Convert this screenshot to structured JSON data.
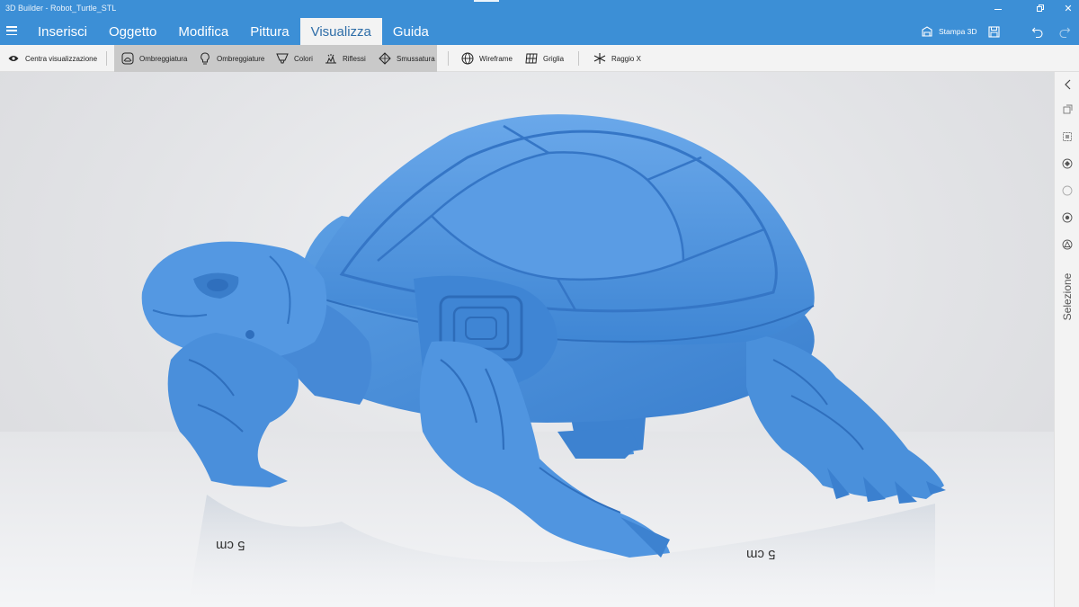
{
  "window": {
    "title": "3D Builder - Robot_Turtle_STL",
    "minimize": "—",
    "maximize": "▢",
    "close": "✕"
  },
  "menu": {
    "hamburger_icon": "hamburger-icon",
    "tabs": [
      {
        "label": "Inserisci"
      },
      {
        "label": "Oggetto"
      },
      {
        "label": "Modifica"
      },
      {
        "label": "Pittura"
      },
      {
        "label": "Visualizza",
        "active": true
      },
      {
        "label": "Guida"
      }
    ],
    "print3d_label": "Stampa 3D",
    "save_icon": "save-icon",
    "undo_icon": "undo-icon",
    "redo_icon": "redo-icon"
  },
  "toolbar": {
    "center_view": "Centra visualizzazione",
    "shading": "Ombreggiatura",
    "shadows": "Ombreggiature",
    "colors": "Colori",
    "reflections": "Riflessi",
    "smoothing": "Smussatura",
    "wireframe": "Wireframe",
    "grid": "Griglia",
    "xray": "Raggio X"
  },
  "viewport": {
    "model_color": "#4a90db",
    "scale_left": "5 cm",
    "scale_right": "5 cm"
  },
  "right_panel": {
    "collapse_icon": "chevron-left-icon",
    "label": "Selezione"
  },
  "colors": {
    "accent": "#3c8fd6",
    "toolbar_bg": "#f3f3f3",
    "active_group": "#c9c9c9"
  }
}
